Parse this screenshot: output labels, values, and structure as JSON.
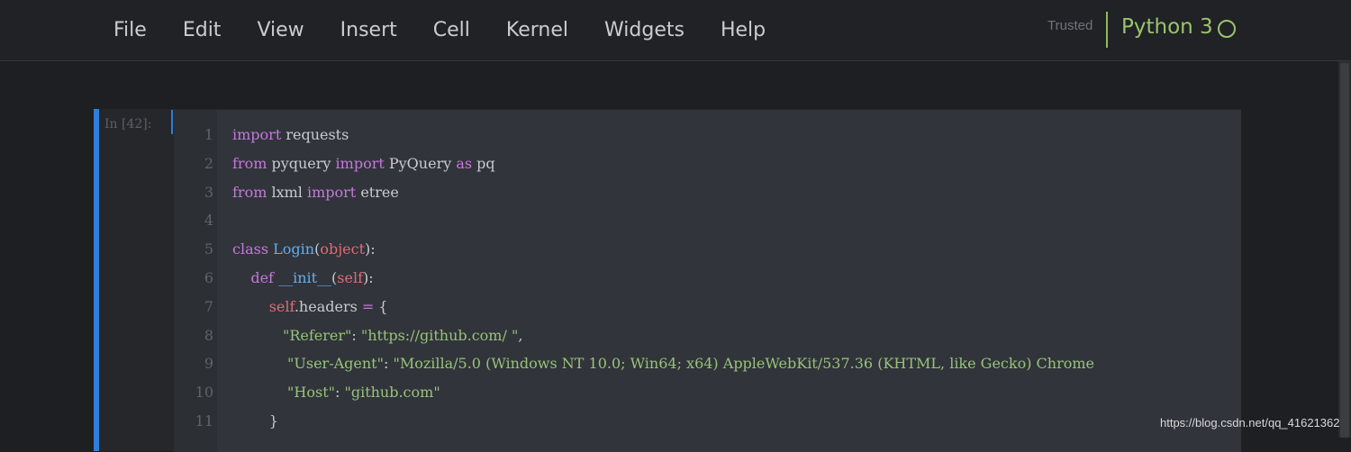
{
  "menu": {
    "items": [
      "File",
      "Edit",
      "View",
      "Insert",
      "Cell",
      "Kernel",
      "Widgets",
      "Help"
    ]
  },
  "status": {
    "trusted": "Trusted",
    "kernel": "Python 3",
    "kernel_indicator_icon": "circle-icon"
  },
  "cell": {
    "prompt": "In  [42]:",
    "line_numbers": [
      "1",
      "2",
      "3",
      "4",
      "5",
      "6",
      "7",
      "8",
      "9",
      "10",
      "11"
    ],
    "lines": [
      [
        {
          "t": "import",
          "c": "kw"
        },
        {
          "t": " requests",
          "c": ""
        }
      ],
      [
        {
          "t": "from",
          "c": "kw"
        },
        {
          "t": " pyquery ",
          "c": ""
        },
        {
          "t": "import",
          "c": "kw"
        },
        {
          "t": " PyQuery ",
          "c": ""
        },
        {
          "t": "as",
          "c": "kw"
        },
        {
          "t": " pq",
          "c": ""
        }
      ],
      [
        {
          "t": "from",
          "c": "kw"
        },
        {
          "t": " lxml ",
          "c": ""
        },
        {
          "t": "import",
          "c": "kw"
        },
        {
          "t": " etree",
          "c": ""
        }
      ],
      [],
      [
        {
          "t": "class",
          "c": "kw"
        },
        {
          "t": " ",
          "c": ""
        },
        {
          "t": "Login",
          "c": "cls"
        },
        {
          "t": "(",
          "c": ""
        },
        {
          "t": "object",
          "c": "bi"
        },
        {
          "t": "):",
          "c": ""
        }
      ],
      [
        {
          "t": "    ",
          "c": ""
        },
        {
          "t": "def",
          "c": "kw"
        },
        {
          "t": " ",
          "c": ""
        },
        {
          "t": "__init__",
          "c": "cls"
        },
        {
          "t": "(",
          "c": ""
        },
        {
          "t": "self",
          "c": "bi"
        },
        {
          "t": "):",
          "c": ""
        }
      ],
      [
        {
          "t": "        ",
          "c": ""
        },
        {
          "t": "self",
          "c": "bi"
        },
        {
          "t": ".headers ",
          "c": ""
        },
        {
          "t": "=",
          "c": "kw"
        },
        {
          "t": " {",
          "c": ""
        }
      ],
      [
        {
          "t": "           ",
          "c": ""
        },
        {
          "t": "\"Referer\"",
          "c": "str"
        },
        {
          "t": ": ",
          "c": ""
        },
        {
          "t": "\"https://github.com/ \"",
          "c": "str"
        },
        {
          "t": ",",
          "c": ""
        }
      ],
      [
        {
          "t": "            ",
          "c": ""
        },
        {
          "t": "\"User-Agent\"",
          "c": "str"
        },
        {
          "t": ": ",
          "c": ""
        },
        {
          "t": "\"Mozilla/5.0 (Windows NT 10.0; Win64; x64) AppleWebKit/537.36 (KHTML, like Gecko) Chrome",
          "c": "str"
        }
      ],
      [
        {
          "t": "            ",
          "c": ""
        },
        {
          "t": "\"Host\"",
          "c": "str"
        },
        {
          "t": ": ",
          "c": ""
        },
        {
          "t": "\"github.com\"",
          "c": "str"
        }
      ],
      [
        {
          "t": "        }",
          "c": ""
        }
      ]
    ]
  },
  "watermark": "https://blog.csdn.net/qq_41621362"
}
